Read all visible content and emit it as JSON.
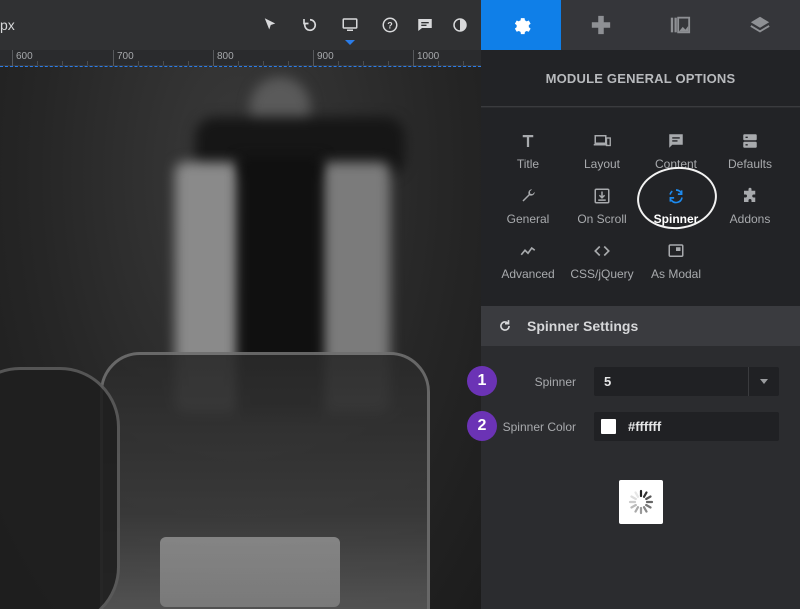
{
  "topbar": {
    "unit_label": "px",
    "tools": [
      {
        "name": "pointer-icon"
      },
      {
        "name": "undo-icon"
      },
      {
        "name": "desktop-icon"
      },
      {
        "name": "help-icon"
      },
      {
        "name": "comments-icon"
      },
      {
        "name": "contrast-icon"
      }
    ]
  },
  "ruler": {
    "marks": [
      "600",
      "700",
      "800",
      "900",
      "1000"
    ]
  },
  "panel": {
    "tabs": [
      {
        "name": "settings-gear-icon",
        "active": true
      },
      {
        "name": "gamepad-icon",
        "active": false
      },
      {
        "name": "library-icon",
        "active": false
      },
      {
        "name": "layers-icon",
        "active": false
      }
    ],
    "title": "MODULE GENERAL OPTIONS",
    "options": [
      {
        "label": "Title",
        "icon": "title-icon"
      },
      {
        "label": "Layout",
        "icon": "layout-icon"
      },
      {
        "label": "Content",
        "icon": "content-icon"
      },
      {
        "label": "Defaults",
        "icon": "defaults-icon"
      },
      {
        "label": "General",
        "icon": "wrench-icon"
      },
      {
        "label": "On Scroll",
        "icon": "on-scroll-icon"
      },
      {
        "label": "Spinner",
        "icon": "spinner-icon"
      },
      {
        "label": "Addons",
        "icon": "puzzle-icon"
      },
      {
        "label": "Advanced",
        "icon": "advanced-icon"
      },
      {
        "label": "CSS/jQuery",
        "icon": "code-icon"
      },
      {
        "label": "As Modal",
        "icon": "modal-icon"
      }
    ],
    "section": {
      "title": "Spinner Settings",
      "spinner_label": "Spinner",
      "spinner_value": "5",
      "color_label": "Spinner Color",
      "color_value": "#ffffff",
      "badge_1": "1",
      "badge_2": "2"
    }
  },
  "colors": {
    "accent": "#0f7fe8",
    "badge": "#6b33b5"
  }
}
